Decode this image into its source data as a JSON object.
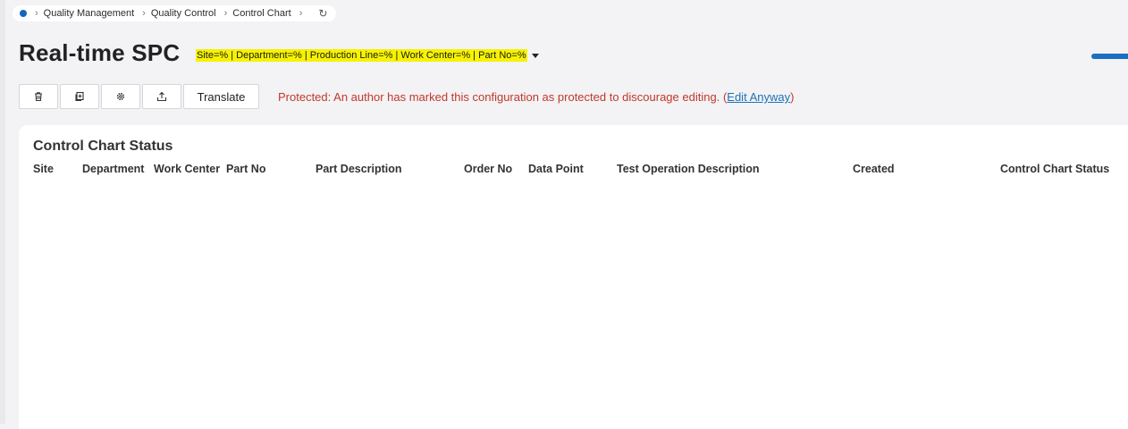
{
  "breadcrumb": {
    "items": [
      "Quality Management",
      "Quality Control",
      "Control Chart"
    ]
  },
  "page": {
    "title": "Real-time SPC",
    "filter": "Site=% | Department=% | Production Line=% | Work Center=% | Part No=%"
  },
  "toolbar": {
    "translate_label": "Translate",
    "icons": [
      "trash-icon",
      "duplicate-icon",
      "gear-icon",
      "export-icon"
    ]
  },
  "protected": {
    "message": "Protected: An author has marked this configuration as protected to discourage editing.",
    "link_open": "(",
    "link_label": "Edit Anyway",
    "link_close": ")"
  },
  "panel": {
    "title": "Control Chart Status",
    "columns": [
      "Site",
      "Department",
      "Work Center",
      "Part No",
      "Part Description",
      "Order No",
      "Data Point",
      "Test Operation Description",
      "Created",
      "Control Chart Status"
    ]
  },
  "colors": {
    "accent": "#1565c0",
    "highlight": "#f6f200",
    "warning": "#c0392b",
    "link": "#1a73b8"
  }
}
